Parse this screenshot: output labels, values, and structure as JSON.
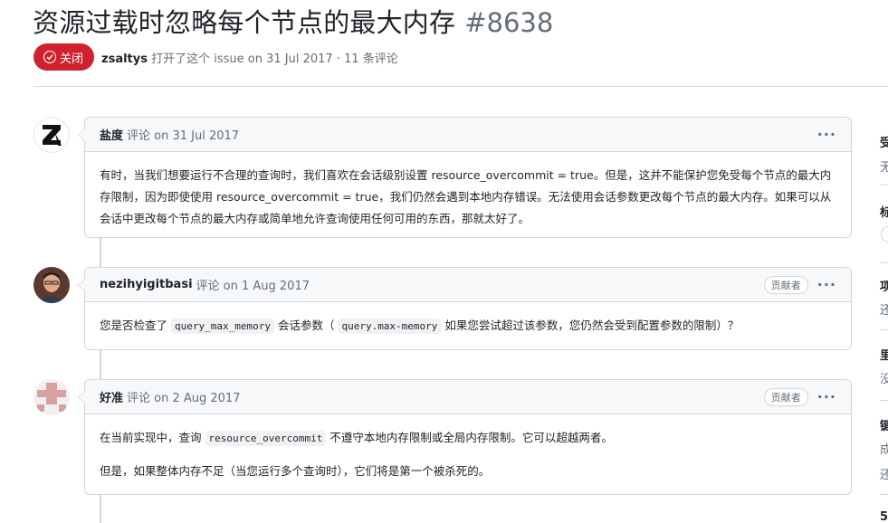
{
  "issue": {
    "title": "资源过载时忽略每个节点的最大内存",
    "number": "#8638",
    "state_label": "关闭",
    "author": "zsaltys",
    "opened_text": "打开了这个 issue on 31 Jul 2017 · 11 条评论"
  },
  "comments": [
    {
      "author": "盐度",
      "action": "评论 on 31 Jul 2017",
      "role": "",
      "body_parts": [
        "有时，当我们想要运行不合理的查询时，我们喜欢在会话级别设置 resource_overcommit = true。但是，这并不能保护您免受每个节点的最大内存限制，因为即使使用 resource_overcommit = true，我们仍然会遇到本地内存错误。无法使用会话参数更改每个节点的最大内存。如果可以从会话中更改每个节点的最大内存或简单地允许查询使用任何可用的东西，那就太好了。"
      ]
    },
    {
      "author": "nezihyigitbasi",
      "action": "评论 on 1 Aug 2017",
      "role": "贡献者",
      "text1": "您是否检查了",
      "code1": "query_max_memory",
      "text2": "会话参数（",
      "code2": "query.max-memory",
      "text3": "如果您尝试超过该参数，您仍然会受到配置参数的限制）？"
    },
    {
      "author": "好准",
      "action": "评论 on 2 Aug 2017",
      "role": "贡献者",
      "p1_text1": "在当前实现中，查询",
      "p1_code": "resource_overcommit",
      "p1_text2": "不遵守本地内存限制或全局内存限制。它可以超越两者。",
      "p2": "但是，如果整体内存不足（当您运行多个查询时），它们将是第一个被杀死的。"
    }
  ],
  "menu_icon": "kebab-horizontal-icon",
  "sidebar": {
    "items": [
      "受",
      "无",
      "标",
      "项",
      "还",
      "里",
      "没",
      "键",
      "成",
      "还",
      "5"
    ]
  },
  "colors": {
    "closed": "#cf222e",
    "border": "#d0d7de",
    "header_bg": "#f6f8fa",
    "muted": "#656d76"
  }
}
